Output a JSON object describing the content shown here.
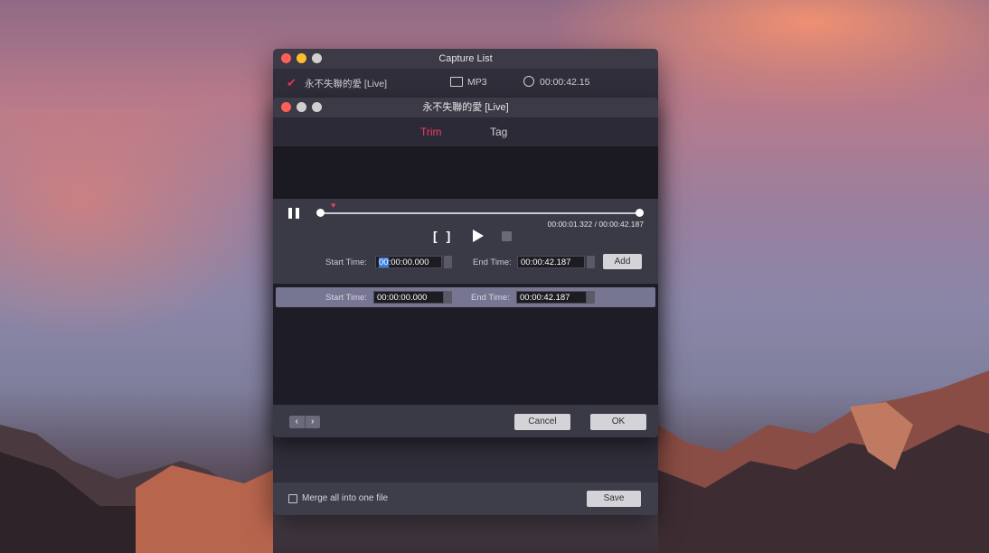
{
  "capture_window": {
    "title": "Capture List",
    "item": {
      "title": "永不失聯的愛 [Live]",
      "format": "MP3",
      "duration": "00:00:42.15"
    },
    "merge_label": "Merge all into one file",
    "save_label": "Save"
  },
  "trim_window": {
    "title": "永不失聯的愛 [Live]",
    "tabs": [
      {
        "label": "Trim",
        "active": true
      },
      {
        "label": "Tag",
        "active": false
      }
    ],
    "time_readout": "00:00:01.322 / 00:00:42.187",
    "start_label": "Start Time:",
    "start_value_selected": "00",
    "start_value_rest": ":00:00.000",
    "end_label": "End Time:",
    "end_value": "00:00:42.187",
    "add_label": "Add",
    "segment": {
      "start_label": "Start Time:",
      "start_value": "00:00:00.000",
      "end_label": "End Time:",
      "end_value": "00:00:42.187"
    },
    "cancel_label": "Cancel",
    "ok_label": "OK"
  },
  "colors": {
    "accent": "#ee3d66",
    "window_bg": "#1e1d27",
    "panel_bg": "#3a3946"
  }
}
